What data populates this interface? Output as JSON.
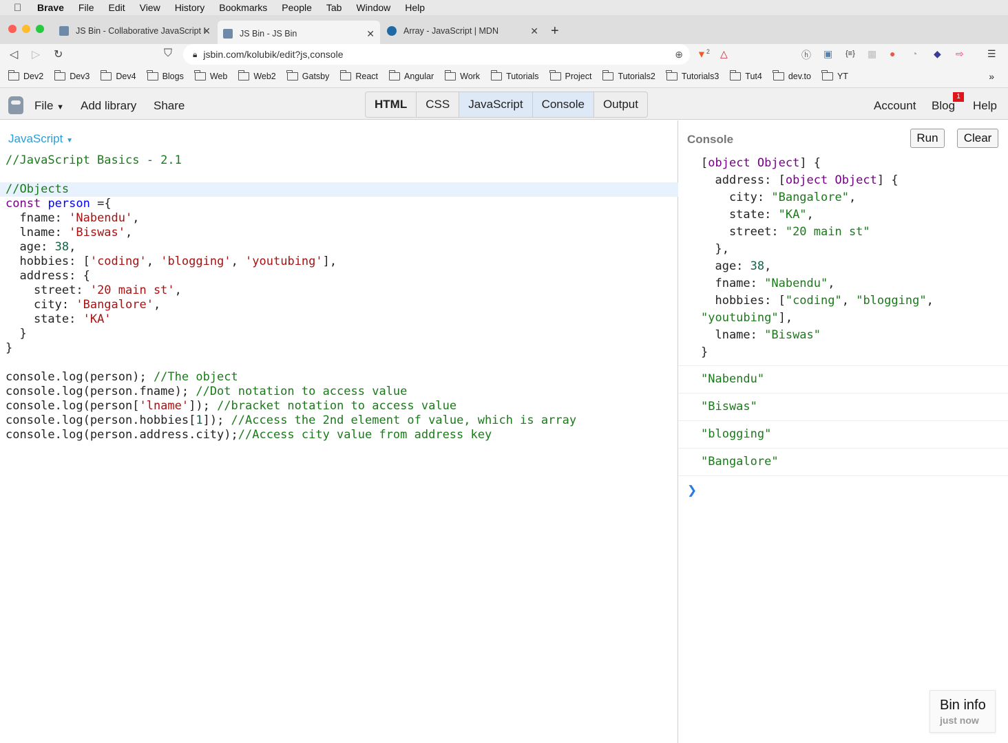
{
  "menubar": {
    "app": "Brave",
    "items": [
      "File",
      "Edit",
      "View",
      "History",
      "Bookmarks",
      "People",
      "Tab",
      "Window",
      "Help"
    ]
  },
  "tabs": [
    {
      "title": "JS Bin - Collaborative JavaScript Debugging"
    },
    {
      "title": "JS Bin - JS Bin"
    },
    {
      "title": "Array - JavaScript | MDN"
    }
  ],
  "toolbar": {
    "url": "jsbin.com/kolubik/edit?js,console",
    "brave_count": "2"
  },
  "bookmarks": [
    "Dev2",
    "Dev3",
    "Dev4",
    "Blogs",
    "Web",
    "Web2",
    "Gatsby",
    "React",
    "Angular",
    "Work",
    "Tutorials",
    "Project",
    "Tutorials2",
    "Tutorials3",
    "Tut4",
    "dev.to",
    "YT"
  ],
  "jsbin": {
    "file": "File",
    "add_library": "Add library",
    "share": "Share",
    "panels": [
      "HTML",
      "CSS",
      "JavaScript",
      "Console",
      "Output"
    ],
    "account": "Account",
    "blog": "Blog",
    "blog_badge": "1",
    "help": "Help"
  },
  "editor": {
    "language": "JavaScript",
    "lines": [
      "//JavaScript Basics - 2.1",
      "",
      "//Objects",
      "const person ={",
      "  fname: 'Nabendu',",
      "  lname: 'Biswas',",
      "  age: 38,",
      "  hobbies: ['coding', 'blogging', 'youtubing'],",
      "  address: {",
      "    street: '20 main st',",
      "    city: 'Bangalore',",
      "    state: 'KA'",
      "  }",
      "}",
      "",
      "console.log(person); //The object",
      "console.log(person.fname); //Dot notation to access value",
      "console.log(person['lname']); //bracket notation to access value",
      "console.log(person.hobbies[1]); //Access the 2nd element of value, which is array",
      "console.log(person.address.city);//Access city value from address key"
    ]
  },
  "console": {
    "title": "Console",
    "run": "Run",
    "clear": "Clear",
    "object_lines": [
      "[object Object] {",
      "  address: [object Object] {",
      "    city: \"Bangalore\",",
      "    state: \"KA\",",
      "    street: \"20 main st\"",
      "  },",
      "  age: 38,",
      "  fname: \"Nabendu\",",
      "  hobbies: [\"coding\", \"blogging\",",
      "\"youtubing\"],",
      "  lname: \"Biswas\"",
      "}"
    ],
    "outputs": [
      "\"Nabendu\"",
      "\"Biswas\"",
      "\"blogging\"",
      "\"Bangalore\""
    ],
    "prompt": "❯"
  },
  "bininfo": {
    "title": "Bin info",
    "subtitle": "just now"
  }
}
